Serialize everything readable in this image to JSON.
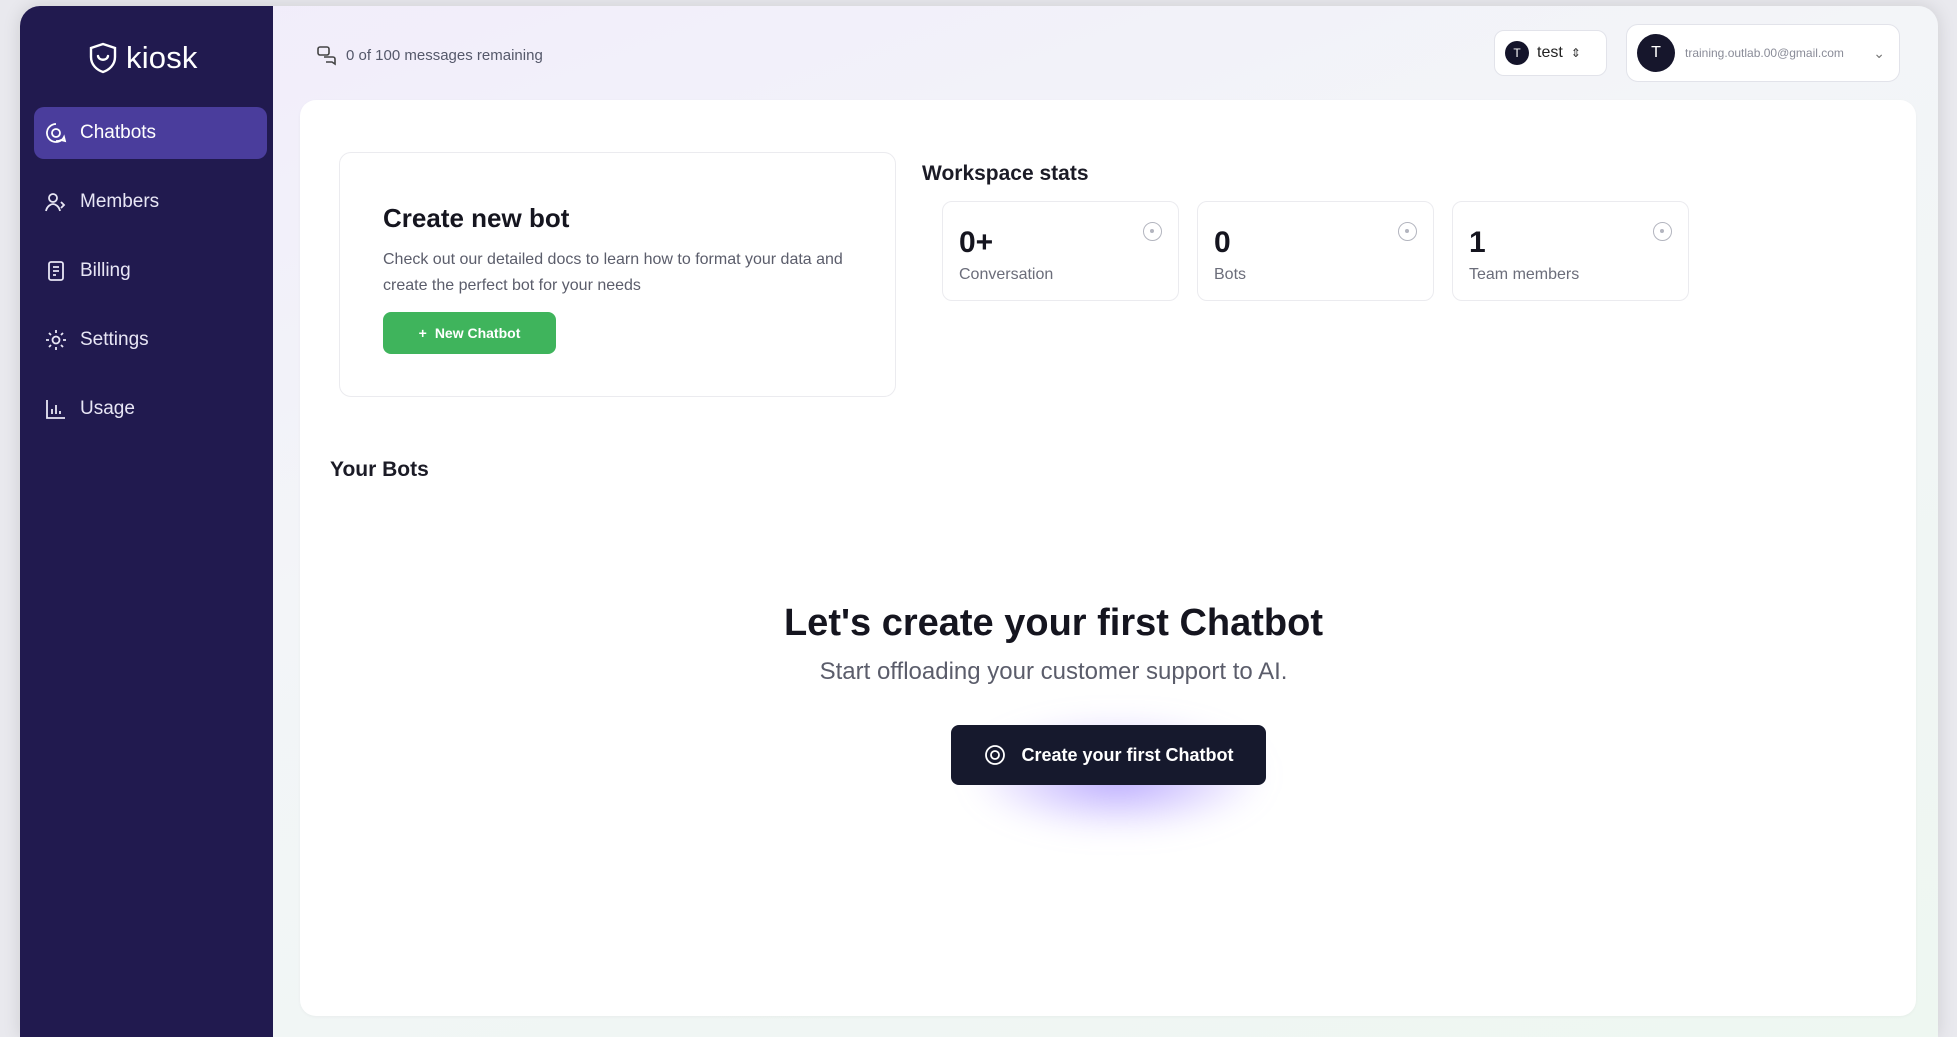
{
  "brand": {
    "name": "kiosk",
    "icon": "shield-logo-icon"
  },
  "sidebar": {
    "items": [
      {
        "label": "Chatbots",
        "icon": "chat-bot-icon",
        "active": true
      },
      {
        "label": "Members",
        "icon": "members-icon",
        "active": false
      },
      {
        "label": "Billing",
        "icon": "billing-icon",
        "active": false
      },
      {
        "label": "Settings",
        "icon": "settings-icon",
        "active": false
      },
      {
        "label": "Usage",
        "icon": "usage-chart-icon",
        "active": false
      }
    ]
  },
  "topbar": {
    "messages_remaining": "0 of 100 messages remaining",
    "workspace": {
      "initial": "T",
      "name": "test"
    },
    "user": {
      "initial": "T",
      "email": "training.outlab.00@gmail.com"
    }
  },
  "create_card": {
    "title": "Create new bot",
    "description": "Check out our detailed docs to learn how to format your data and create the perfect bot for your needs",
    "button_label": "New Chatbot"
  },
  "stats": {
    "title": "Workspace stats",
    "items": [
      {
        "value": "0+",
        "label": "Conversation"
      },
      {
        "value": "0",
        "label": "Bots"
      },
      {
        "value": "1",
        "label": "Team members"
      }
    ]
  },
  "bots": {
    "title": "Your Bots",
    "empty_title": "Let's create your first Chatbot",
    "empty_subtitle": "Start offloading your customer support to AI.",
    "cta_label": "Create your first Chatbot"
  },
  "colors": {
    "sidebar": "#211a4f",
    "active_nav": "#4a3d9c",
    "primary_green": "#3fb45c",
    "cta_dark": "#16192d"
  }
}
